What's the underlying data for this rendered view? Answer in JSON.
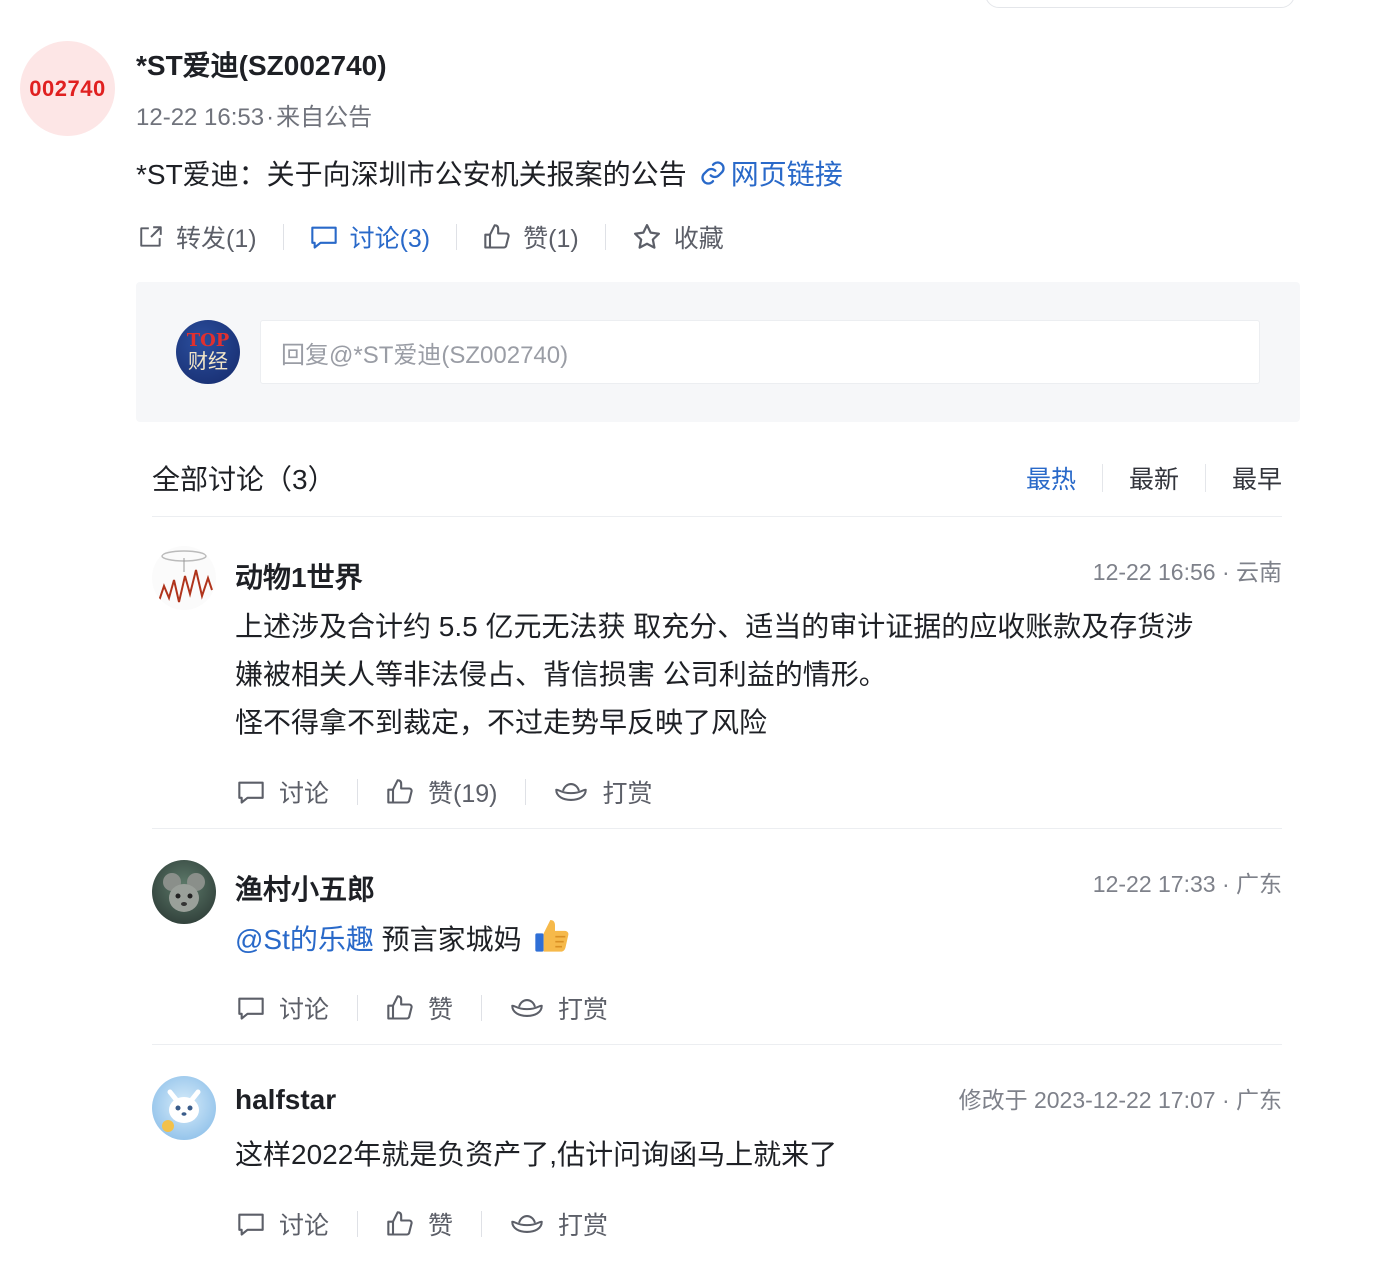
{
  "post": {
    "avatar_text": "002740",
    "stock_name": "*ST爱迪(SZ002740)",
    "time": "12-22 16:53",
    "separator": "·",
    "source": "来自公告",
    "title": "*ST爱迪：关于向深圳市公安机关报案的公告",
    "link_label": "网页链接"
  },
  "actions": {
    "forward": "转发(1)",
    "discuss": "讨论(3)",
    "like": "赞(1)",
    "favorite": "收藏"
  },
  "reply": {
    "avatar_top": "TOP",
    "avatar_sub": "财经",
    "placeholder": "回复@*ST爱迪(SZ002740)"
  },
  "discussion": {
    "title": "全部讨论（3）",
    "sort_hot": "最热",
    "sort_new": "最新",
    "sort_early": "最早"
  },
  "comments": [
    {
      "author": "动物1世界",
      "time": "12-22 16:56 · 云南",
      "lines": [
        "上述涉及合计约 5.5 亿元无法获 取充分、适当的审计证据的应收账款及存货涉",
        "嫌被相关人等非法侵占、背信损害 公司利益的情形。",
        "怪不得拿不到裁定，不过走势早反映了风险"
      ],
      "discuss": "讨论",
      "like": "赞(19)",
      "reward": "打赏"
    },
    {
      "author": "渔村小五郎",
      "time": "12-22 17:33 · 广东",
      "mention": "@St的乐趣",
      "text": " 预言家城妈",
      "discuss": "讨论",
      "like": "赞",
      "reward": "打赏"
    },
    {
      "author": "halfstar",
      "time": "修改于 2023-12-22 17:07 · 广东",
      "text": "这样2022年就是负资产了,估计问询函马上就来了",
      "discuss": "讨论",
      "like": "赞",
      "reward": "打赏"
    }
  ],
  "colors": {
    "accent": "#2969c9",
    "stock_red": "#e02020",
    "avatar_bg": "#fde6e6"
  }
}
